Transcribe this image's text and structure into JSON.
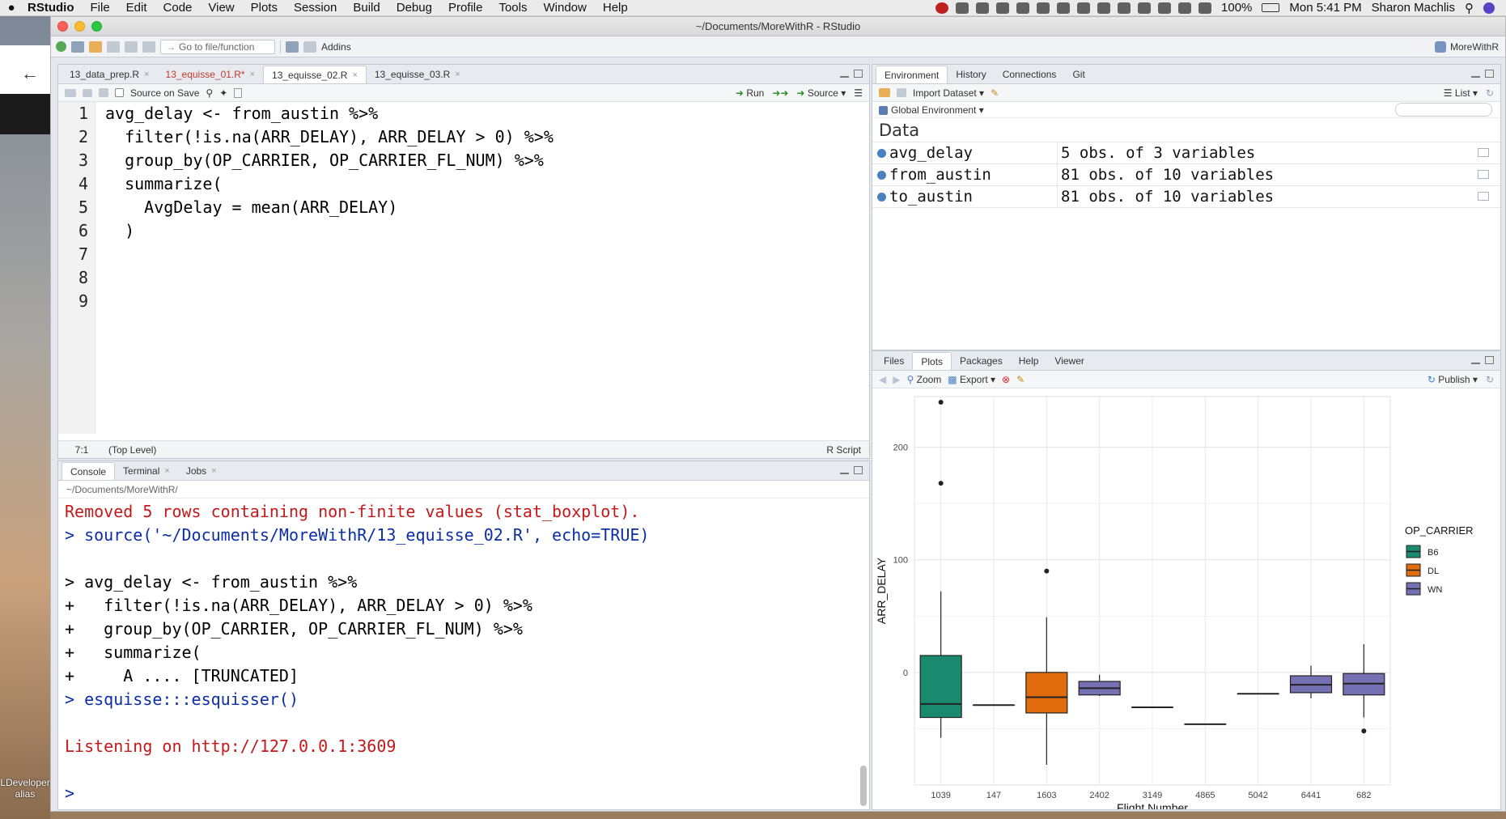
{
  "menubar": {
    "app": "RStudio",
    "items": [
      "File",
      "Edit",
      "Code",
      "View",
      "Plots",
      "Session",
      "Build",
      "Debug",
      "Profile",
      "Tools",
      "Window",
      "Help"
    ],
    "battery": "100%",
    "clock": "Mon 5:41 PM",
    "user": "Sharon Machlis"
  },
  "desktop": {
    "icon_label": "LDeveloper alias"
  },
  "window": {
    "title": "~/Documents/MoreWithR - RStudio"
  },
  "toolbar": {
    "goto_placeholder": "Go to file/function",
    "addins": "Addins",
    "project": "MoreWithR"
  },
  "editor": {
    "tabs": [
      {
        "label": "13_data_prep.R",
        "unsaved": false,
        "active": false
      },
      {
        "label": "13_equisse_01.R*",
        "unsaved": true,
        "active": false
      },
      {
        "label": "13_equisse_02.R",
        "unsaved": false,
        "active": true
      },
      {
        "label": "13_equisse_03.R",
        "unsaved": false,
        "active": false
      }
    ],
    "source_on_save": "Source on Save",
    "run": "Run",
    "source": "Source",
    "lines": [
      "avg_delay <- from_austin %>%",
      "  filter(!is.na(ARR_DELAY), ARR_DELAY > 0) %>%",
      "  group_by(OP_CARRIER, OP_CARRIER_FL_NUM) %>%",
      "  summarize(",
      "    AvgDelay = mean(ARR_DELAY)",
      "  )",
      "",
      "",
      ""
    ],
    "line_numbers": [
      "1",
      "2",
      "3",
      "4",
      "5",
      "6",
      "7",
      "8",
      "9"
    ],
    "status_pos": "7:1",
    "status_scope": "(Top Level)",
    "status_type": "R Script"
  },
  "console": {
    "tabs": [
      {
        "label": "Console",
        "active": true
      },
      {
        "label": "Terminal",
        "active": false
      },
      {
        "label": "Jobs",
        "active": false
      }
    ],
    "path": "~/Documents/MoreWithR/",
    "lines": [
      {
        "text": "Removed 5 rows containing non-finite values (stat_boxplot).",
        "kind": "err"
      },
      {
        "text": "> source('~/Documents/MoreWithR/13_equisse_02.R', echo=TRUE)",
        "kind": "cmd"
      },
      {
        "text": "",
        "kind": "echo"
      },
      {
        "text": "> avg_delay <- from_austin %>%",
        "kind": "echo"
      },
      {
        "text": "+   filter(!is.na(ARR_DELAY), ARR_DELAY > 0) %>%",
        "kind": "echo"
      },
      {
        "text": "+   group_by(OP_CARRIER, OP_CARRIER_FL_NUM) %>%",
        "kind": "echo"
      },
      {
        "text": "+   summarize(",
        "kind": "echo"
      },
      {
        "text": "+     A .... [TRUNCATED]",
        "kind": "echo"
      },
      {
        "text": "> esquisse:::esquisser()",
        "kind": "cmd"
      },
      {
        "text": "",
        "kind": "echo"
      },
      {
        "text": "Listening on http://127.0.0.1:3609",
        "kind": "err"
      },
      {
        "text": "",
        "kind": "echo"
      },
      {
        "text": ">",
        "kind": "cmd"
      }
    ]
  },
  "environment": {
    "tabs": [
      {
        "label": "Environment",
        "active": true
      },
      {
        "label": "History",
        "active": false
      },
      {
        "label": "Connections",
        "active": false
      },
      {
        "label": "Git",
        "active": false
      }
    ],
    "import_dataset": "Import Dataset",
    "view_mode": "List",
    "scope": "Global Environment",
    "section": "Data",
    "rows": [
      {
        "name": "avg_delay",
        "value": "5 obs. of 3 variables"
      },
      {
        "name": "from_austin",
        "value": "81 obs. of 10 variables"
      },
      {
        "name": "to_austin",
        "value": "81 obs. of 10 variables"
      }
    ]
  },
  "plots": {
    "tabs": [
      {
        "label": "Files",
        "active": false
      },
      {
        "label": "Plots",
        "active": true
      },
      {
        "label": "Packages",
        "active": false
      },
      {
        "label": "Help",
        "active": false
      },
      {
        "label": "Viewer",
        "active": false
      }
    ],
    "zoom": "Zoom",
    "export": "Export",
    "publish": "Publish"
  },
  "chart_data": {
    "type": "boxplot",
    "xlabel": "Flight Number",
    "ylabel": "ARR_DELAY",
    "legend_title": "OP_CARRIER",
    "legend_position": "right",
    "grid": true,
    "ylim": [
      -100,
      245
    ],
    "yticks": [
      0,
      100,
      200
    ],
    "categories": [
      "1039",
      "147",
      "1603",
      "2402",
      "3149",
      "4865",
      "5042",
      "6441",
      "682"
    ],
    "series_colors": {
      "B6": "#1a8a6e",
      "DL": "#e06c0e",
      "WN": "#7570b3"
    },
    "legend": [
      "B6",
      "DL",
      "WN"
    ],
    "boxes": [
      {
        "category": "1039",
        "carrier": "B6",
        "min": -58,
        "q1": -40,
        "median": -28,
        "q3": 15,
        "max": 72,
        "outliers": [
          240,
          168
        ]
      },
      {
        "category": "147",
        "carrier": "B6",
        "min": -29,
        "q1": -29,
        "median": -29,
        "q3": -29,
        "max": -29,
        "outliers": []
      },
      {
        "category": "1603",
        "carrier": "DL",
        "min": -82,
        "q1": -36,
        "median": -22,
        "q3": 0,
        "max": 49,
        "outliers": [
          90
        ]
      },
      {
        "category": "2402",
        "carrier": "WN",
        "min": -21,
        "q1": -20,
        "median": -14,
        "q3": -8,
        "max": -2,
        "outliers": []
      },
      {
        "category": "3149",
        "carrier": "WN",
        "min": -31,
        "q1": -31,
        "median": -31,
        "q3": -31,
        "max": -31,
        "outliers": []
      },
      {
        "category": "4865",
        "carrier": "WN",
        "min": -46,
        "q1": -46,
        "median": -46,
        "q3": -46,
        "max": -46,
        "outliers": []
      },
      {
        "category": "5042",
        "carrier": "WN",
        "min": -19,
        "q1": -19,
        "median": -19,
        "q3": -19,
        "max": -19,
        "outliers": []
      },
      {
        "category": "6441",
        "carrier": "WN",
        "min": -23,
        "q1": -18,
        "median": -11,
        "q3": -3,
        "max": 6,
        "outliers": []
      },
      {
        "category": "682",
        "carrier": "WN",
        "min": -40,
        "q1": -20,
        "median": -10,
        "q3": -1,
        "max": 25,
        "outliers": [
          -52
        ]
      }
    ]
  }
}
